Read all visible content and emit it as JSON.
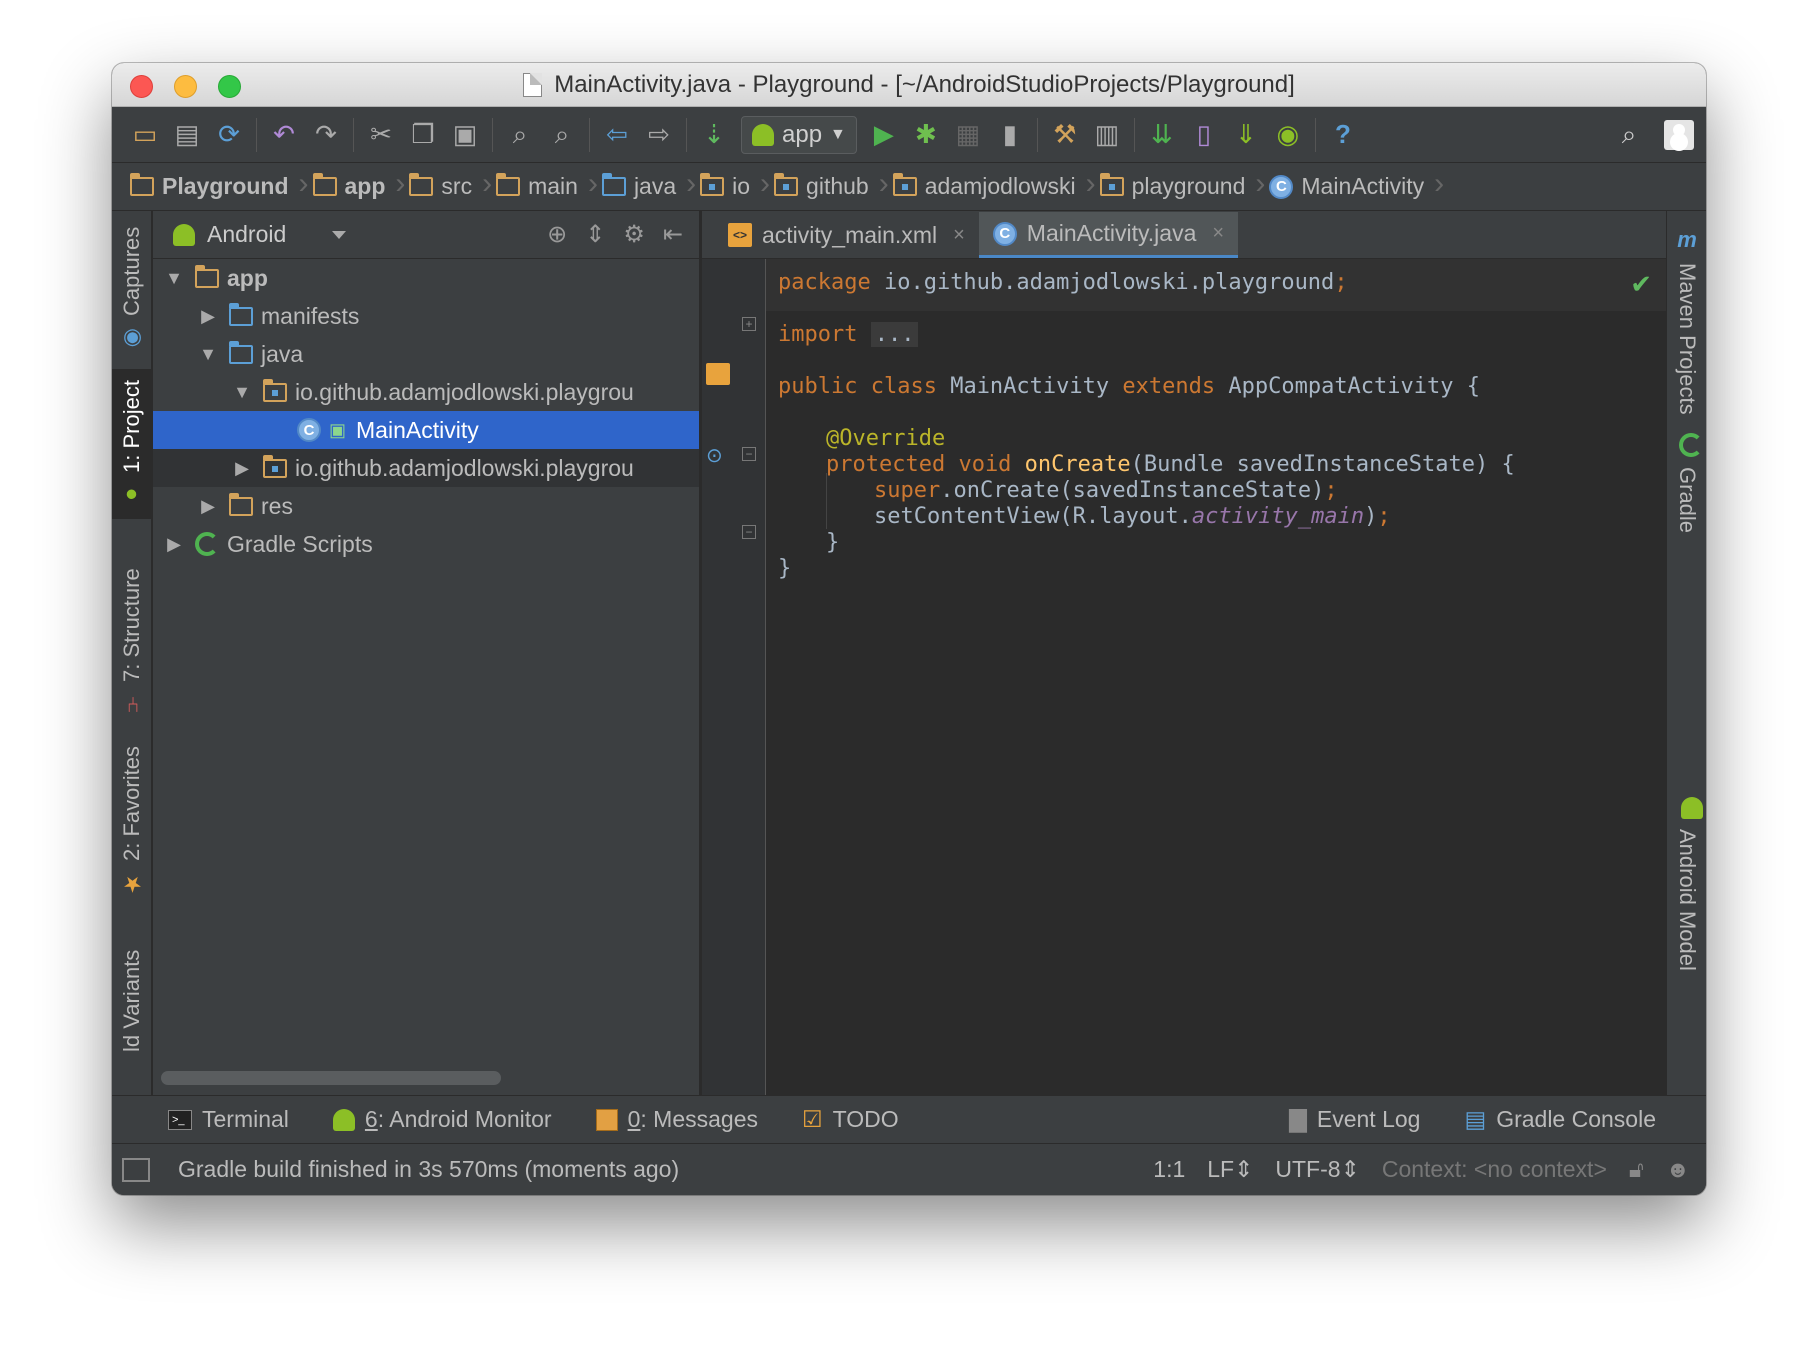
{
  "window": {
    "title": "MainActivity.java - Playground - [~/AndroidStudioProjects/Playground]"
  },
  "toolbar": {
    "run_config": "app",
    "help_label": "?"
  },
  "breadcrumb": [
    {
      "label": "Playground",
      "icon": "project-folder-icon"
    },
    {
      "label": "app",
      "icon": "module-folder-icon"
    },
    {
      "label": "src",
      "icon": "folder-icon"
    },
    {
      "label": "main",
      "icon": "folder-icon"
    },
    {
      "label": "java",
      "icon": "source-folder-icon"
    },
    {
      "label": "io",
      "icon": "package-icon"
    },
    {
      "label": "github",
      "icon": "package-icon"
    },
    {
      "label": "adamjodlowski",
      "icon": "package-icon"
    },
    {
      "label": "playground",
      "icon": "package-icon"
    },
    {
      "label": "MainActivity",
      "icon": "class-icon"
    }
  ],
  "left_tabs": {
    "captures": "Captures",
    "project": "1: Project",
    "structure": "7: Structure",
    "favorites": "2: Favorites",
    "build_variants": "ld Variants"
  },
  "right_tabs": {
    "maven": "Maven Projects",
    "maven_icon": "m",
    "gradle": "Gradle",
    "android_model": "Android Model"
  },
  "project_panel": {
    "view_mode": "Android",
    "tree": [
      {
        "label": "app",
        "expanded": true
      },
      {
        "label": "manifests"
      },
      {
        "label": "java",
        "expanded": true
      },
      {
        "label": "io.github.adamjodlowski.playgrou"
      },
      {
        "label": "MainActivity",
        "selected": true
      },
      {
        "label": "io.github.adamjodlowski.playgrou"
      },
      {
        "label": "res"
      },
      {
        "label": "Gradle Scripts"
      }
    ]
  },
  "editor": {
    "tabs": [
      {
        "label": "activity_main.xml",
        "close": "×"
      },
      {
        "label": "MainActivity.java",
        "close": "×"
      }
    ],
    "code": {
      "l1_kw": "package",
      "l1_rest": " io.github.adamjodlowski.playground",
      "l1_semi": ";",
      "l2_kw": "import",
      "l2_fold": "...",
      "l3_kw": "public class",
      "l3_name": " MainActivity ",
      "l3_kw2": "extends",
      "l3_rest": " AppCompatActivity {",
      "l4_ann": "@Override",
      "l5_kw": "protected void",
      "l5_fn": " onCreate",
      "l5_rest": "(Bundle savedInstanceState) {",
      "l6_kw": "super",
      "l6_rest": ".onCreate(savedInstanceState)",
      "l6_semi": ";",
      "l7_pre": "setContentView(R.layout.",
      "l7_field": "activity_main",
      "l7_post": ")",
      "l7_semi": ";",
      "l8": "}",
      "l9": "}"
    },
    "check_mark": "✔"
  },
  "bottom_tabs": {
    "terminal": "Terminal",
    "android_monitor_num": "6",
    "android_monitor_rest": ": Android Monitor",
    "messages_num": "0",
    "messages_rest": ": Messages",
    "todo": "TODO",
    "event_log": "Event Log",
    "gradle_console": "Gradle Console"
  },
  "status_bar": {
    "message": "Gradle build finished in 3s 570ms (moments ago)",
    "position": "1:1",
    "line_sep": "LF",
    "encoding": "UTF-8",
    "context": "Context: <no context>"
  }
}
